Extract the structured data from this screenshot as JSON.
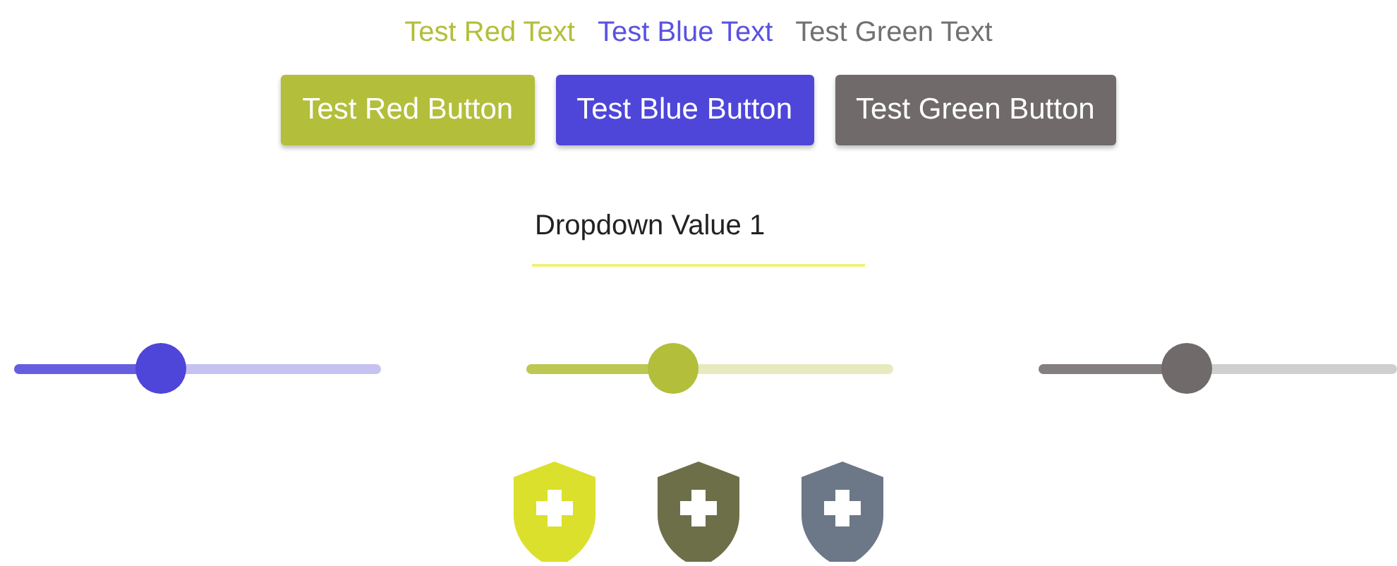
{
  "texts": [
    {
      "label": "Test Red Text",
      "color": "#b3be3a"
    },
    {
      "label": "Test Blue Text",
      "color": "#5a52e0"
    },
    {
      "label": "Test Green Text",
      "color": "#727070"
    }
  ],
  "buttons": [
    {
      "label": "Test Red Button",
      "color": "#b3be3a"
    },
    {
      "label": "Test Blue Button",
      "color": "#4e45d9"
    },
    {
      "label": "Test Green Button",
      "color": "#706a6a"
    }
  ],
  "dropdown": {
    "value": "Dropdown Value 1"
  },
  "sliders": [
    {
      "level": 0.4,
      "color": "#4e45d9"
    },
    {
      "level": 0.4,
      "color": "#b3be3a"
    },
    {
      "level": 0.415,
      "color": "#706a6a"
    }
  ],
  "shields": [
    {
      "color": "#dbe02c"
    },
    {
      "color": "#6d6f48"
    },
    {
      "color": "#6c7788"
    }
  ]
}
